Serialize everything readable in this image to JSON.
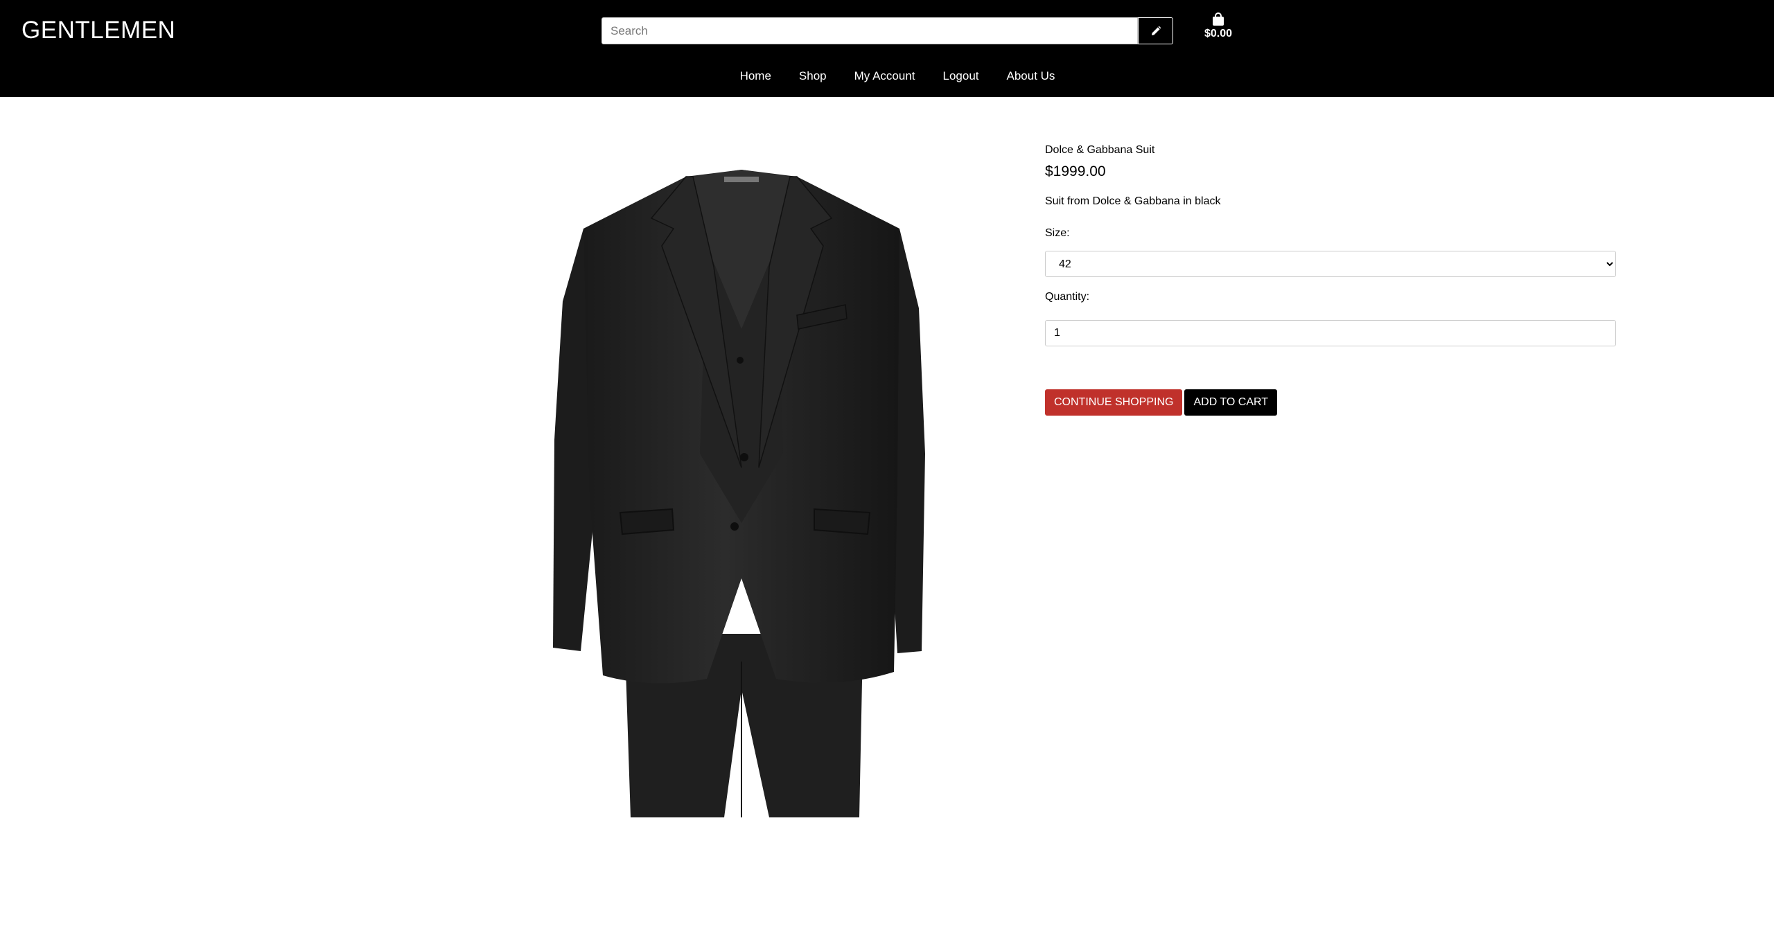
{
  "header": {
    "logo": "GENTLEMEN",
    "search_placeholder": "Search",
    "search_button_icon": "pencil-icon",
    "cart_icon": "shopping-bag-icon",
    "cart_total": "$0.00"
  },
  "nav": {
    "items": [
      "Home",
      "Shop",
      "My Account",
      "Logout",
      "About Us"
    ]
  },
  "product": {
    "image_alt": "black suit",
    "name": "Dolce & Gabbana Suit",
    "price": "$1999.00",
    "description": "Suit from Dolce & Gabbana in black",
    "size_label": "Size:",
    "size_value": "42",
    "quantity_label": "Quantity:",
    "quantity_value": "1",
    "continue_label": "CONTINUE SHOPPING",
    "add_label": "ADD TO CART"
  },
  "colors": {
    "header_bg": "#000000",
    "continue_btn": "#c0312b",
    "add_btn": "#000000"
  }
}
